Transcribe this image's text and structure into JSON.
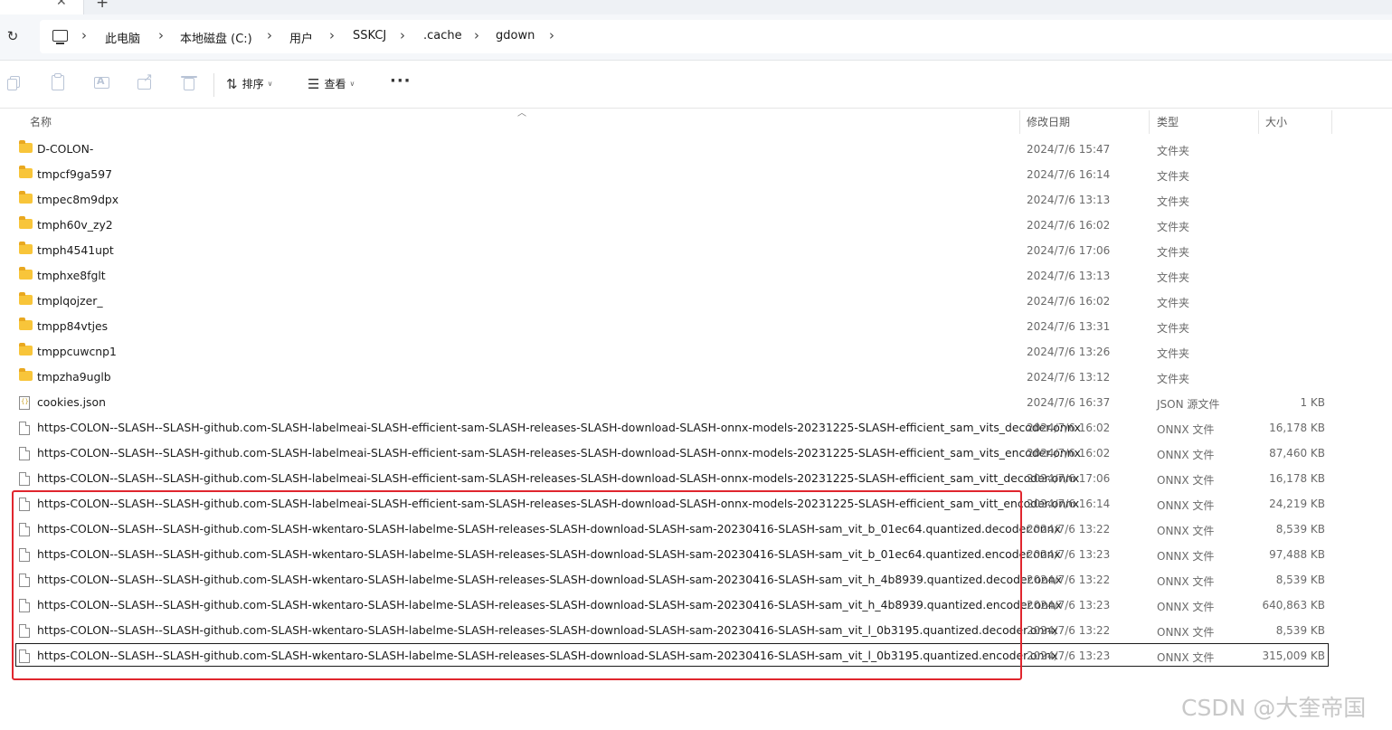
{
  "address_bar": {
    "crumbs": [
      "此电脑",
      "本地磁盘 (C:)",
      "用户",
      "SSKCJ",
      ".cache",
      "gdown"
    ]
  },
  "toolbar": {
    "sort_label": "排序",
    "view_label": "查看",
    "more_label": "···"
  },
  "columns": {
    "name": "名称",
    "modified": "修改日期",
    "type": "类型",
    "size": "大小"
  },
  "files": [
    {
      "name": "D-COLON-",
      "date": "2024/7/6 15:47",
      "type": "文件夹",
      "size": "",
      "icon": "folder-icon"
    },
    {
      "name": "tmpcf9ga597",
      "date": "2024/7/6 16:14",
      "type": "文件夹",
      "size": "",
      "icon": "folder-icon"
    },
    {
      "name": "tmpec8m9dpx",
      "date": "2024/7/6 13:13",
      "type": "文件夹",
      "size": "",
      "icon": "folder-icon"
    },
    {
      "name": "tmph60v_zy2",
      "date": "2024/7/6 16:02",
      "type": "文件夹",
      "size": "",
      "icon": "folder-icon"
    },
    {
      "name": "tmph4541upt",
      "date": "2024/7/6 17:06",
      "type": "文件夹",
      "size": "",
      "icon": "folder-icon"
    },
    {
      "name": "tmphxe8fglt",
      "date": "2024/7/6 13:13",
      "type": "文件夹",
      "size": "",
      "icon": "folder-icon"
    },
    {
      "name": "tmplqojzer_",
      "date": "2024/7/6 16:02",
      "type": "文件夹",
      "size": "",
      "icon": "folder-icon"
    },
    {
      "name": "tmpp84vtjes",
      "date": "2024/7/6 13:31",
      "type": "文件夹",
      "size": "",
      "icon": "folder-icon"
    },
    {
      "name": "tmppcuwcnp1",
      "date": "2024/7/6 13:26",
      "type": "文件夹",
      "size": "",
      "icon": "folder-icon"
    },
    {
      "name": "tmpzha9uglb",
      "date": "2024/7/6 13:12",
      "type": "文件夹",
      "size": "",
      "icon": "folder-icon"
    },
    {
      "name": "cookies.json",
      "date": "2024/7/6 16:37",
      "type": "JSON 源文件",
      "size": "1 KB",
      "icon": "json-file-icon"
    },
    {
      "name": "https-COLON--SLASH--SLASH-github.com-SLASH-labelmeai-SLASH-efficient-sam-SLASH-releases-SLASH-download-SLASH-onnx-models-20231225-SLASH-efficient_sam_vits_decoder.onnx",
      "date": "2024/7/6 16:02",
      "type": "ONNX 文件",
      "size": "16,178 KB",
      "icon": "file-icon"
    },
    {
      "name": "https-COLON--SLASH--SLASH-github.com-SLASH-labelmeai-SLASH-efficient-sam-SLASH-releases-SLASH-download-SLASH-onnx-models-20231225-SLASH-efficient_sam_vits_encoder.onnx",
      "date": "2024/7/6 16:02",
      "type": "ONNX 文件",
      "size": "87,460 KB",
      "icon": "file-icon"
    },
    {
      "name": "https-COLON--SLASH--SLASH-github.com-SLASH-labelmeai-SLASH-efficient-sam-SLASH-releases-SLASH-download-SLASH-onnx-models-20231225-SLASH-efficient_sam_vitt_decoder.onnx",
      "date": "2024/7/6 17:06",
      "type": "ONNX 文件",
      "size": "16,178 KB",
      "icon": "file-icon"
    },
    {
      "name": "https-COLON--SLASH--SLASH-github.com-SLASH-labelmeai-SLASH-efficient-sam-SLASH-releases-SLASH-download-SLASH-onnx-models-20231225-SLASH-efficient_sam_vitt_encoder.onnx",
      "date": "2024/7/6 16:14",
      "type": "ONNX 文件",
      "size": "24,219 KB",
      "icon": "file-icon"
    },
    {
      "name": "https-COLON--SLASH--SLASH-github.com-SLASH-wkentaro-SLASH-labelme-SLASH-releases-SLASH-download-SLASH-sam-20230416-SLASH-sam_vit_b_01ec64.quantized.decoder.onnx",
      "date": "2024/7/6 13:22",
      "type": "ONNX 文件",
      "size": "8,539 KB",
      "icon": "file-icon"
    },
    {
      "name": "https-COLON--SLASH--SLASH-github.com-SLASH-wkentaro-SLASH-labelme-SLASH-releases-SLASH-download-SLASH-sam-20230416-SLASH-sam_vit_b_01ec64.quantized.encoder.onnx",
      "date": "2024/7/6 13:23",
      "type": "ONNX 文件",
      "size": "97,488 KB",
      "icon": "file-icon"
    },
    {
      "name": "https-COLON--SLASH--SLASH-github.com-SLASH-wkentaro-SLASH-labelme-SLASH-releases-SLASH-download-SLASH-sam-20230416-SLASH-sam_vit_h_4b8939.quantized.decoder.onnx",
      "date": "2024/7/6 13:22",
      "type": "ONNX 文件",
      "size": "8,539 KB",
      "icon": "file-icon"
    },
    {
      "name": "https-COLON--SLASH--SLASH-github.com-SLASH-wkentaro-SLASH-labelme-SLASH-releases-SLASH-download-SLASH-sam-20230416-SLASH-sam_vit_h_4b8939.quantized.encoder.onnx",
      "date": "2024/7/6 13:23",
      "type": "ONNX 文件",
      "size": "640,863 KB",
      "icon": "file-icon"
    },
    {
      "name": "https-COLON--SLASH--SLASH-github.com-SLASH-wkentaro-SLASH-labelme-SLASH-releases-SLASH-download-SLASH-sam-20230416-SLASH-sam_vit_l_0b3195.quantized.decoder.onnx",
      "date": "2024/7/6 13:22",
      "type": "ONNX 文件",
      "size": "8,539 KB",
      "icon": "file-icon"
    },
    {
      "name": "https-COLON--SLASH--SLASH-github.com-SLASH-wkentaro-SLASH-labelme-SLASH-releases-SLASH-download-SLASH-sam-20230416-SLASH-sam_vit_l_0b3195.quantized.encoder.onnx",
      "date": "2024/7/6 13:23",
      "type": "ONNX 文件",
      "size": "315,009 KB",
      "icon": "file-icon",
      "focused": true
    }
  ],
  "watermark": "CSDN @大奎帝国",
  "colors": {
    "annotation_red": "#e0262e",
    "folder_yellow": "#f8c53a"
  }
}
